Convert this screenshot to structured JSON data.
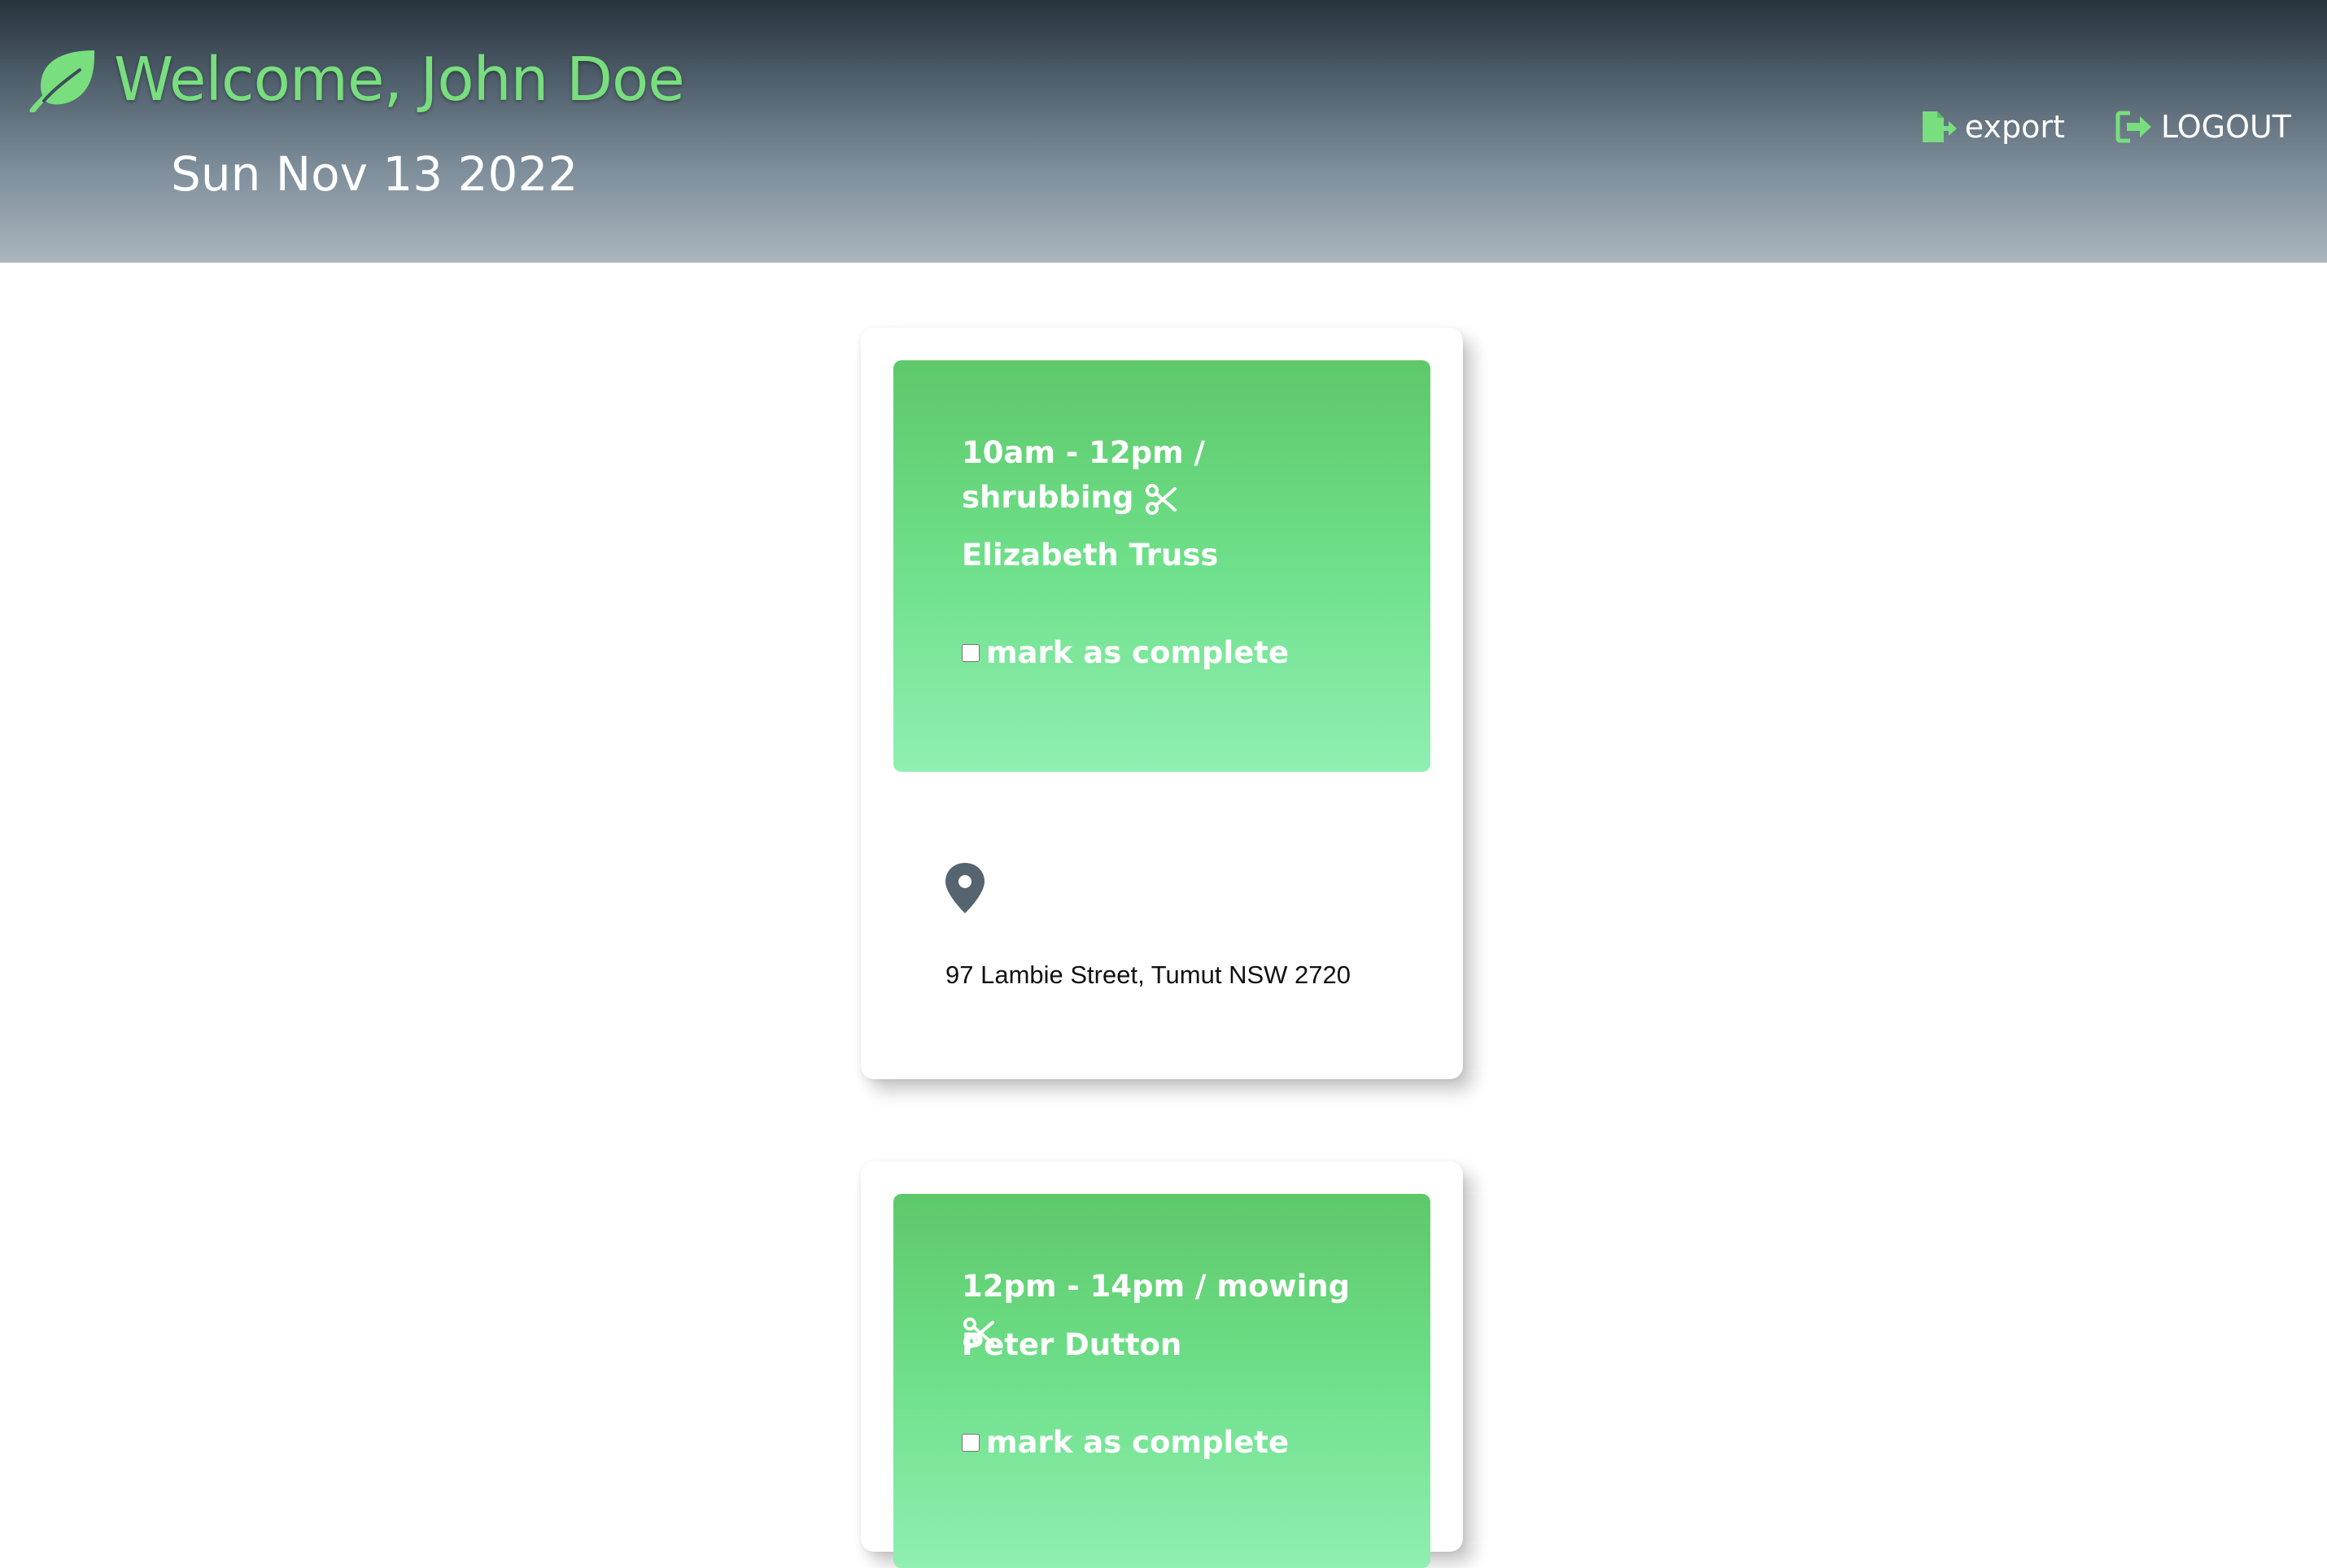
{
  "header": {
    "welcome": "Welcome, John Doe",
    "date": "Sun Nov 13 2022",
    "nav": {
      "export_label": "export",
      "logout_label": "LOGOUT"
    }
  },
  "jobs": [
    {
      "time_task": "10am - 12pm / shrubbing",
      "client": "Elizabeth Truss",
      "complete_label": "mark as complete",
      "completed": false,
      "address": "97 Lambie Street, Tumut NSW 2720"
    },
    {
      "time_task": "12pm - 14pm / mowing",
      "client": "Peter Dutton",
      "complete_label": "mark as complete",
      "completed": false
    }
  ],
  "colors": {
    "accent_green": "#78de7e",
    "panel_top": "#5ec869",
    "panel_bottom": "#90efb2",
    "header_top": "#27323c",
    "header_bottom": "#aab5bd",
    "pin": "#55646f"
  },
  "icons": [
    "leaf-icon",
    "export-icon",
    "logout-icon",
    "scissors-icon",
    "map-pin-icon"
  ]
}
